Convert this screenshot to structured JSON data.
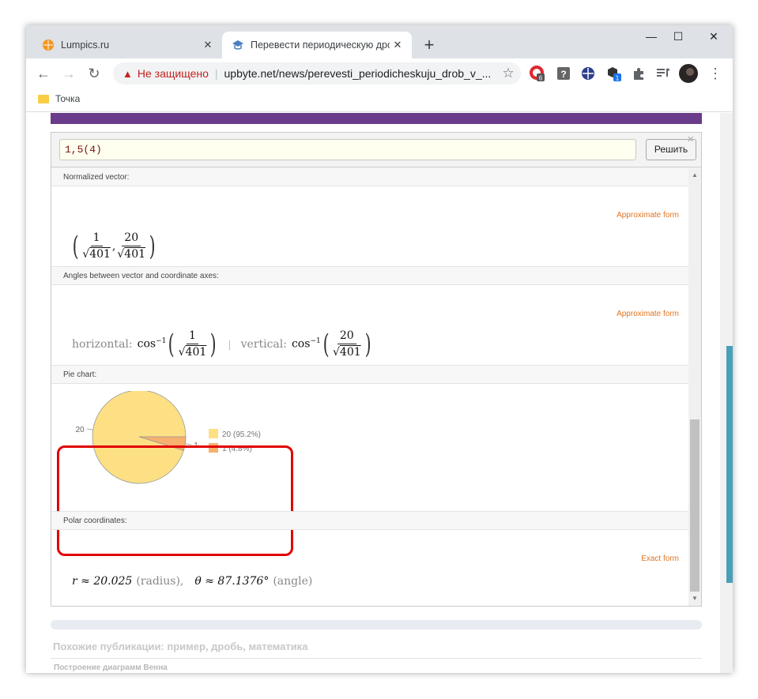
{
  "browser": {
    "tabs": [
      {
        "title": "Lumpics.ru",
        "favicon": "lumpics-orange-circle",
        "active": false
      },
      {
        "title": "Перевести периодическую дро",
        "favicon": "mortarboard-icon",
        "active": true
      }
    ],
    "new_tab_label": "+",
    "window_controls": {
      "minimize": "—",
      "maximize": "☐",
      "close": "✕"
    },
    "address": {
      "warning": "Не защищено",
      "url": "upbyte.net/news/perevesti_periodicheskuju_drob_v_..."
    },
    "extensions": [
      {
        "name": "opera-icon",
        "badge": "6"
      },
      {
        "name": "help-icon"
      },
      {
        "name": "vpn-globe-icon"
      },
      {
        "name": "cube-icon",
        "badge": "1"
      },
      {
        "name": "puzzle-icon"
      },
      {
        "name": "media-queue-icon"
      },
      {
        "name": "profile-avatar"
      }
    ],
    "bookmarks": [
      {
        "label": "Точка"
      }
    ]
  },
  "widget": {
    "query": "1,5(4)",
    "solve_label": "Решить",
    "close_label": "✕"
  },
  "pods": {
    "normalized": {
      "header": "Normalized vector:",
      "form_link": "Approximate form",
      "a_num": "1",
      "a_den": "401",
      "b_num": "20",
      "b_den": "401"
    },
    "angles": {
      "header": "Angles between vector and coordinate axes:",
      "form_link": "Approximate form",
      "horizontal_label": "horizontal:",
      "vertical_label": "vertical:",
      "cos": "cos",
      "exp": "−1",
      "h_num": "1",
      "h_den": "401",
      "v_num": "20",
      "v_den": "401",
      "separator": "|"
    },
    "pie": {
      "header": "Pie chart:"
    },
    "polar": {
      "header": "Polar coordinates:",
      "form_link": "Exact form",
      "r_text": "r ≈ 20.025",
      "r_label": "(radius),",
      "theta_text": "θ ≈ 87.1376°",
      "theta_label": "(angle)"
    }
  },
  "chart_data": {
    "type": "pie",
    "categories": [
      "20",
      "1"
    ],
    "values": [
      20,
      1
    ],
    "slice_labels": [
      "20",
      "1"
    ],
    "legend": [
      "20 (95.2%)",
      "1 (4.8%)"
    ],
    "legend_placement": "right",
    "colors": [
      "#fde083",
      "#f6b06f"
    ]
  },
  "below": {
    "similar_title": "Похожие публикации: пример, дробь, математика",
    "similar_link": "Построение диаграмм Венна"
  }
}
